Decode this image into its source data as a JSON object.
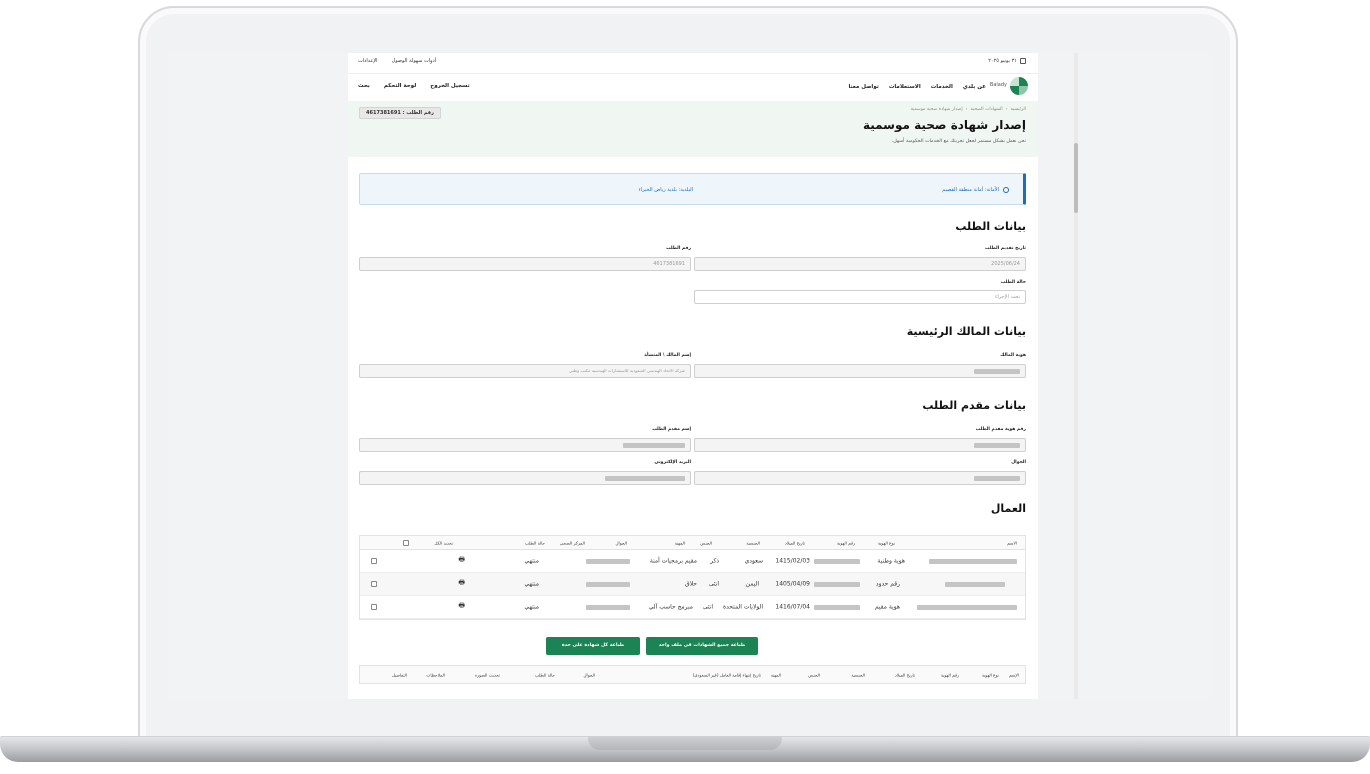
{
  "topbar": {
    "date": "٣١ يونيو ٢٠٢٥",
    "accessibility": "أدوات سهولة الوصول",
    "settings": "الإعدادات"
  },
  "navbar": {
    "logo_name": "Balady",
    "nav_items": [
      "عن بلدي",
      "الخدمات",
      "الاستعلامات",
      "تواصل معنا"
    ],
    "search": "بحث",
    "dashboard": "لوحة التحكم",
    "logout": "تسجيل الخروج"
  },
  "hero": {
    "breadcrumb": [
      "الرئيسية",
      "الشهادات الصحية",
      "إصدار شهادة صحية موسمية"
    ],
    "title": "إصدار شهادة صحية موسمية",
    "subtitle": "نحن نعمل بشكل مستمر لجعل تجربتك مع الخدمات الحكومية أسهل.",
    "request_number": "رقم الطلب : 4617381691"
  },
  "info": {
    "amanah": "الأمانة: أمانة منطقة القصيم",
    "baladiya": "البلدية: بلدية رياض الخبراء"
  },
  "request_section": {
    "title": "بيانات الطلب",
    "submit_date_label": "تاريخ تقديم الطلب",
    "submit_date_value": "2025/06/24",
    "request_number_label": "رقم الطلب",
    "request_number_value": "4617381691",
    "status_label": "حالة الطلب",
    "status_value": "تحت الإجراء"
  },
  "owner_section": {
    "title": "بيانات المالك الرئيسية",
    "owner_id_label": "هوية المالك",
    "owner_name_label": "إسم المالك \\ المنشأة",
    "owner_name_value": "شركة الاتحاد الهندسي السعودية للاستشارات الهندسية مكتب وطني"
  },
  "applicant_section": {
    "title": "بيانات مقدم الطلب",
    "applicant_id_label": "رقم هوية مقدم الطلب",
    "applicant_name_label": "إسم مقدم الطلب",
    "mobile_label": "الجوال",
    "email_label": "البريد الإلكتروني"
  },
  "workers_section": {
    "title": "العمال",
    "headers": [
      "الاسم",
      "نوع الهوية",
      "رقم الهوية",
      "تاريخ الميلاد",
      "الجنسية",
      "الجنس",
      "المهنة",
      "الجوال",
      "المركز الصحي",
      "حالة الطلب",
      "",
      "تحديد الكل"
    ],
    "rows": [
      {
        "id_type": "هوية وطنية",
        "birth": "1415/02/03",
        "nationality": "سعودي",
        "gender": "ذكر",
        "job": "مقيم برمجيات أمنة",
        "status": "منتهي"
      },
      {
        "id_type": "رقم حدود",
        "birth": "1405/04/09",
        "nationality": "اليمن",
        "gender": "انثى",
        "job": "حلاق",
        "status": "منتهي"
      },
      {
        "id_type": "هوية مقيم",
        "birth": "1416/07/04",
        "nationality": "الولايات المتحدة",
        "gender": "انثى",
        "job": "مبرمج حاسب آلي",
        "status": "منتهي"
      }
    ]
  },
  "buttons": {
    "print_all_one_file": "طباعة جميع الشهادات في ملف واحد",
    "print_each": "طباعة كل شهادة على حدة"
  },
  "bottom_table": {
    "headers": [
      "الإسم",
      "نوع الهوية",
      "رقم الهوية",
      "تاريخ الميلاد",
      "الجنسية",
      "الجنس",
      "المهنة",
      "تاريخ إنتهاء إقامة العامل (غير السعودي)",
      "الجوال",
      "حالة الطلب",
      "تحديث الصورة",
      "الملاحظات",
      "التفاصيل"
    ]
  }
}
